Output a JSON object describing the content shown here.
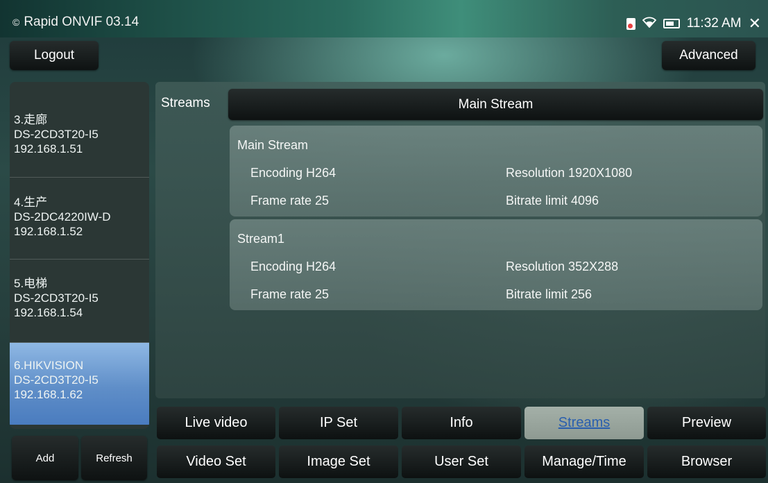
{
  "status_bar": {
    "app_title": "Rapid ONVIF 03.14",
    "time": "11:32 AM",
    "icons": [
      "copyright-icon",
      "sd-card-icon",
      "wifi-icon",
      "battery-icon",
      "close-icon"
    ]
  },
  "top_bar": {
    "logout_label": "Logout",
    "advanced_label": "Advanced"
  },
  "device_list": {
    "items": [
      {
        "name": "3.走廊",
        "model": "DS-2CD3T20-I5",
        "ip": "192.168.1.51",
        "selected": false
      },
      {
        "name": "4.生产",
        "model": "DS-2DC4220IW-D",
        "ip": "192.168.1.52",
        "selected": false
      },
      {
        "name": "5.电梯",
        "model": "DS-2CD3T20-I5",
        "ip": "192.168.1.54",
        "selected": false
      },
      {
        "name": "6.HIKVISION",
        "model": "DS-2CD3T20-I5",
        "ip": "192.168.1.62",
        "selected": true
      }
    ],
    "add_label": "Add",
    "refresh_label": "Refresh"
  },
  "streams_panel": {
    "label": "Streams",
    "selected_stream": "Main Stream",
    "cards": [
      {
        "title": "Main Stream",
        "encoding": "Encoding H264",
        "frame_rate": "Frame rate 25",
        "resolution": "Resolution 1920X1080",
        "bitrate": "Bitrate limit  4096"
      },
      {
        "title": "Stream1",
        "encoding": "Encoding H264",
        "frame_rate": "Frame rate 25",
        "resolution": "Resolution 352X288",
        "bitrate": "Bitrate limit  256"
      }
    ]
  },
  "tabs": {
    "row1": [
      "Live video",
      "IP Set",
      "Info",
      "Streams",
      "Preview"
    ],
    "row2": [
      "Video Set",
      "Image Set",
      "User Set",
      "Manage/Time",
      "Browser"
    ],
    "active": "Streams"
  },
  "colors": {
    "selected_device": "#6d9ad2",
    "active_tab_text": "#2a5fae",
    "button_dark": "#141818"
  }
}
